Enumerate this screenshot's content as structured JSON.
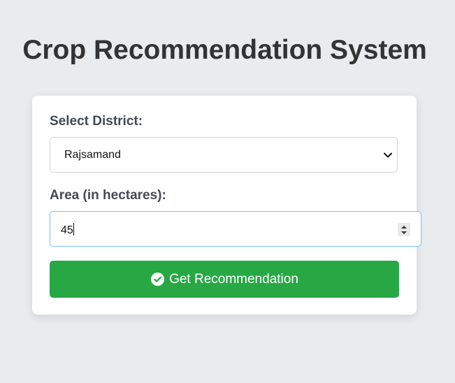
{
  "page": {
    "title": "Crop Recommendation System"
  },
  "form": {
    "district_label": "Select District:",
    "district_selected": "Rajsamand",
    "area_label": "Area (in hectares):",
    "area_value": "45",
    "submit_label": "Get Recommendation",
    "submit_icon": "check-circle-icon"
  },
  "colors": {
    "background": "#e9ecef",
    "card": "#ffffff",
    "button": "#28a745",
    "input_focus_border": "#80bdff",
    "title": "#333333"
  }
}
